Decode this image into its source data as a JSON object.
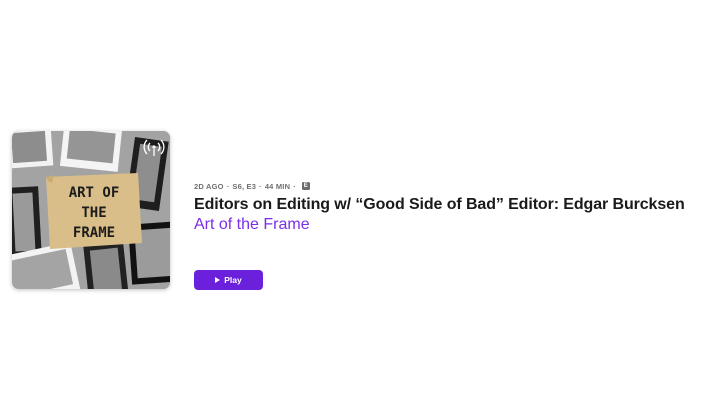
{
  "episode": {
    "age": "2D AGO",
    "season_episode": "S6, E3",
    "duration": "44 MIN",
    "explicit_badge": "E",
    "title": "Editors on Editing w/ “Good Side of Bad” Editor: Edgar Burcksen",
    "show_name": "Art of the Frame",
    "play_label": "Play"
  },
  "artwork": {
    "line1": "ART OF",
    "line2": "THE",
    "line3": "FRAME",
    "icon": "podcast-antenna-icon"
  },
  "colors": {
    "accent": "#6b20dc",
    "show_link": "#7a2ee6"
  }
}
